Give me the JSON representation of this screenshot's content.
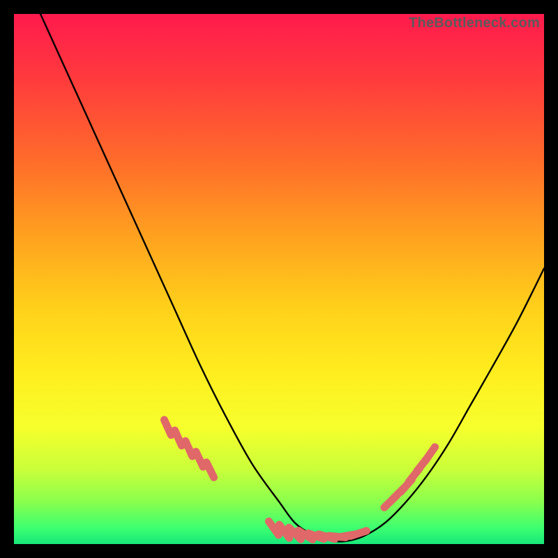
{
  "watermark": "TheBottleneck.com",
  "colors": {
    "curve_stroke": "#000000",
    "marker_fill": "#e06868",
    "marker_stroke": "#c94f4f"
  },
  "chart_data": {
    "type": "line",
    "title": "",
    "xlabel": "",
    "ylabel": "",
    "xlim": [
      0,
      100
    ],
    "ylim": [
      0,
      100
    ],
    "grid": false,
    "legend": false,
    "series": [
      {
        "name": "bottleneck-curve",
        "x": [
          5,
          10,
          15,
          20,
          25,
          30,
          35,
          40,
          45,
          50,
          53,
          56,
          59,
          61,
          63,
          66,
          70,
          74,
          78,
          82,
          86,
          90,
          95,
          100
        ],
        "y": [
          100,
          89,
          78,
          67,
          56,
          45,
          34,
          24,
          15,
          8,
          4,
          2,
          1,
          0.5,
          0.6,
          1.5,
          4,
          8,
          13,
          19,
          26,
          33,
          42,
          52
        ]
      }
    ],
    "markers": [
      {
        "x": 29,
        "y": 22
      },
      {
        "x": 31,
        "y": 20
      },
      {
        "x": 33,
        "y": 18
      },
      {
        "x": 35,
        "y": 16
      },
      {
        "x": 37,
        "y": 14
      },
      {
        "x": 49,
        "y": 3
      },
      {
        "x": 51,
        "y": 2.4
      },
      {
        "x": 53,
        "y": 2.0
      },
      {
        "x": 55,
        "y": 1.7
      },
      {
        "x": 57,
        "y": 1.5
      },
      {
        "x": 59,
        "y": 1.4
      },
      {
        "x": 61,
        "y": 1.4
      },
      {
        "x": 63,
        "y": 1.6
      },
      {
        "x": 65,
        "y": 2.0
      },
      {
        "x": 71,
        "y": 8
      },
      {
        "x": 72.5,
        "y": 9.5
      },
      {
        "x": 74,
        "y": 11
      },
      {
        "x": 75.5,
        "y": 13
      },
      {
        "x": 77,
        "y": 15
      },
      {
        "x": 78.5,
        "y": 17
      }
    ]
  }
}
